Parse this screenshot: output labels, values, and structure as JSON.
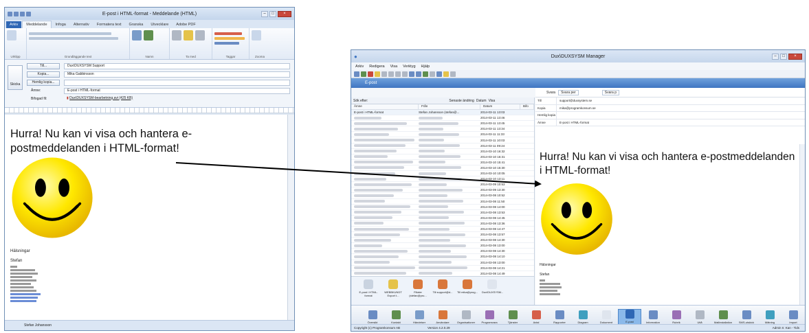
{
  "left_window": {
    "title": "E-post i HTML-format - Meddelande (HTML)",
    "tabs": [
      "Arkiv",
      "Meddelande",
      "Infoga",
      "Alternativ",
      "Formatera text",
      "Granska",
      "Utvecklare",
      "Adobe PDF"
    ],
    "ribbon_groups": [
      "Urklipp",
      "Grundläggande text",
      "Namn",
      "Ta med",
      "Taggar",
      "Zooma"
    ],
    "send_label": "Skicka",
    "header_rows": [
      {
        "label": "Till...",
        "value": "Dux\\DUXSYSM Support"
      },
      {
        "label": "Kopia...",
        "value": "Mika Gabbinsson"
      },
      {
        "label": "Hemlig kopia...",
        "value": ""
      },
      {
        "label": "Ämne:",
        "value": "E-post i HTML-format"
      },
      {
        "label": "Bifogad fil:",
        "value": "Dux\\DUXSYSM-bearbetning.avi (425 KB)"
      }
    ],
    "status_name": "Stefan Johansson"
  },
  "right_window": {
    "title": "Dux\\DUXSYSM Manager",
    "menu": [
      "Arkiv",
      "Redigera",
      "Visa",
      "Verktyg",
      "Hjälp"
    ],
    "blue_bar_label": "E-post",
    "list_header": {
      "left": "Sök efter:",
      "mid": "Senaste ändring",
      "b1": "Datum",
      "b2": "Visa"
    },
    "columns": [
      "Ämne",
      "Från",
      "Datum",
      "Bifo"
    ],
    "first_row": {
      "subject": "E-post i HTML-format",
      "from": "Stefan Johansson (stefan@...",
      "date": "2014-03-11 13:03"
    },
    "dates": [
      "2014-03-11 13:46",
      "2014-03-11 13:45",
      "2014-03-11 13:34",
      "2014-03-11 11:33",
      "2014-03-11 10:03",
      "2014-03-11 09:24",
      "2014-03-10 16:32",
      "2014-03-10 16:31",
      "2014-03-10 15:41",
      "2014-03-10 15:30",
      "2014-03-10 10:05",
      "2014-03-10 13:11",
      "2014-03-09 10:53",
      "2014-03-09 13:30",
      "2014-03-08 10:52",
      "2014-03-08 11:50",
      "2014-03-08 14:00",
      "2014-03-08 13:53",
      "2014-03-08 14:45",
      "2014-03-08 13:36",
      "2014-03-08 14:47",
      "2014-03-08 13:57",
      "2014-03-08 14:30",
      "2014-03-08 13:00",
      "2014-03-08 14:30",
      "2014-03-08 14:10",
      "2014-03-08 13:00",
      "2014-03-08 14:21",
      "2014-03-08 14:49",
      "2014-03-08 14:53"
    ],
    "detail_toolbar": {
      "reply": "Svara",
      "reply_value": "Svara per",
      "forward": "Svara p"
    },
    "detail_rows": [
      {
        "label": "Till",
        "value": "support@duxsystem.se"
      },
      {
        "label": "Kopia",
        "value": "mika@programkonsum.se"
      },
      {
        "label": "Hemlig kopia",
        "value": ""
      },
      {
        "label": "Ämne",
        "value": "E-post i HTML-format"
      }
    ],
    "shortcuts": [
      "E-post i HTML-format",
      "WEBBKUNDT Export t...",
      "Filialer (stefan@pro...",
      "Till support@d...",
      "Till mika@prog...",
      "Dux\\DUXSYSM..."
    ],
    "bottom_nav": [
      "Översikt",
      "Kontakt",
      "Händelser",
      "Användare",
      "Organisationer",
      "Programvara",
      "Tjänster",
      "Avtal",
      "Rapporter",
      "Diagram",
      "Dokument",
      "E-post",
      "Information",
      "Rubrik",
      "Utlå",
      "Mailinstallation",
      "SMS-utskick",
      "Mätning",
      "Import"
    ],
    "status": {
      "left": "Copyright (c) Programkonsum AB",
      "mid": "Version 4.2.0.29",
      "right": "Admin   Ir. Kan - Tids"
    }
  },
  "message": {
    "heading": "Hurra! Nu kan vi visa och hantera e-postmeddelanden i HTML-format!",
    "greeting": "Hälsningar",
    "name": "Stefan"
  },
  "colors": {
    "accent": "#2f67b5",
    "smiley": "#ffe000",
    "nav_active": "#8bb9ea"
  }
}
